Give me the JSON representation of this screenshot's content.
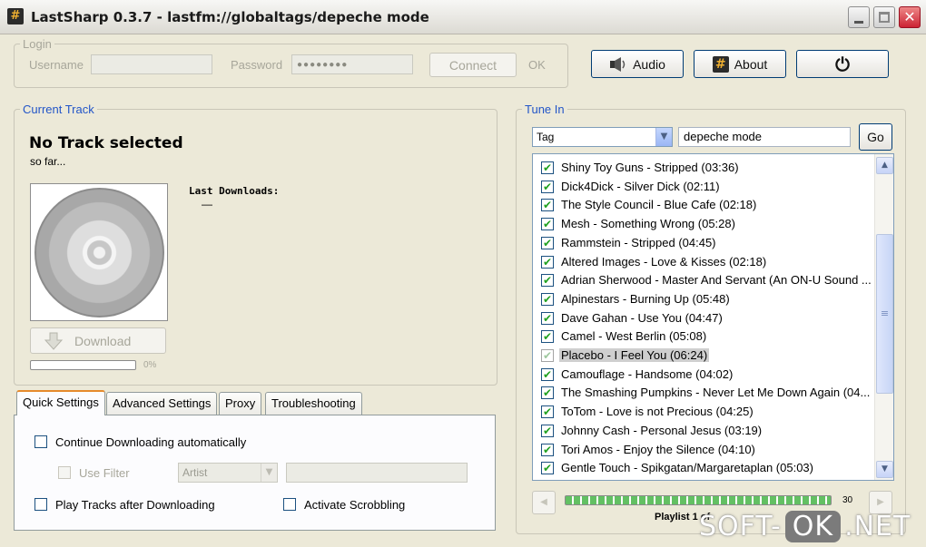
{
  "window": {
    "app_icon": "#",
    "title": "LastSharp 0.3.7 - lastfm://globaltags/depeche mode",
    "close_glyph": "✕"
  },
  "login": {
    "legend": "Login",
    "username_label": "Username",
    "username_value": "",
    "password_label": "Password",
    "password_value": "●●●●●●●●",
    "connect_label": "Connect",
    "status": "OK"
  },
  "toolbar": {
    "audio_label": "Audio",
    "about_label": "About",
    "about_icon_glyph": "#",
    "power_icon_glyph": "⏻"
  },
  "current_track": {
    "legend": "Current Track",
    "title": "No Track selected",
    "subtitle": "so far...",
    "last_downloads_label": "Last Downloads:",
    "last_downloads_value": "—",
    "download_label": "Download",
    "progress_text": "0%",
    "progress_fraction": 0
  },
  "tabs": [
    {
      "label": "Quick Settings",
      "active": true
    },
    {
      "label": "Advanced Settings",
      "active": false
    },
    {
      "label": "Proxy",
      "active": false
    },
    {
      "label": "Troubleshooting",
      "active": false
    }
  ],
  "quick_settings": {
    "continue_downloading": "Continue Downloading automatically",
    "use_filter": "Use Filter",
    "filter_select": "Artist",
    "filter_text": "",
    "play_tracks": "Play Tracks after Downloading",
    "activate_scrobbling": "Activate Scrobbling"
  },
  "tune_in": {
    "legend": "Tune In",
    "type_select": "Tag",
    "query": "depeche mode",
    "go_label": "Go"
  },
  "playlist": {
    "check_glyph": "✔",
    "items": [
      {
        "text": "Shiny Toy Guns - Stripped (03:36)",
        "checked": true,
        "selected": false
      },
      {
        "text": "Dick4Dick - Silver Dick (02:11)",
        "checked": true,
        "selected": false
      },
      {
        "text": "The Style Council - Blue Cafe (02:18)",
        "checked": true,
        "selected": false
      },
      {
        "text": "Mesh - Something Wrong (05:28)",
        "checked": true,
        "selected": false
      },
      {
        "text": "Rammstein - Stripped (04:45)",
        "checked": true,
        "selected": false
      },
      {
        "text": "Altered Images - Love & Kisses (02:18)",
        "checked": true,
        "selected": false
      },
      {
        "text": "Adrian Sherwood - Master And Servant (An ON-U Sound ...",
        "checked": true,
        "selected": false
      },
      {
        "text": "Alpinestars - Burning Up (05:48)",
        "checked": true,
        "selected": false
      },
      {
        "text": "Dave Gahan - Use You (04:47)",
        "checked": true,
        "selected": false
      },
      {
        "text": "Camel - West Berlin (05:08)",
        "checked": true,
        "selected": false
      },
      {
        "text": "Placebo - I Feel You (06:24)",
        "checked": true,
        "selected": true
      },
      {
        "text": "Camouflage - Handsome (04:02)",
        "checked": true,
        "selected": false
      },
      {
        "text": "The Smashing Pumpkins - Never Let Me Down Again (04...",
        "checked": true,
        "selected": false
      },
      {
        "text": "ToTom - Love is not Precious (04:25)",
        "checked": true,
        "selected": false
      },
      {
        "text": "Johnny Cash - Personal Jesus (03:19)",
        "checked": true,
        "selected": false
      },
      {
        "text": "Tori Amos - Enjoy the Silence (04:10)",
        "checked": true,
        "selected": false
      },
      {
        "text": "Gentle Touch - Spikgatan/Margaretaplan (05:03)",
        "checked": true,
        "selected": false
      }
    ],
    "progress_count": "30",
    "progress_fraction": 1,
    "status": "Playlist 1 of"
  },
  "watermark": {
    "left": "SOFT-",
    "mid": "OK",
    "right": ".NET"
  }
}
